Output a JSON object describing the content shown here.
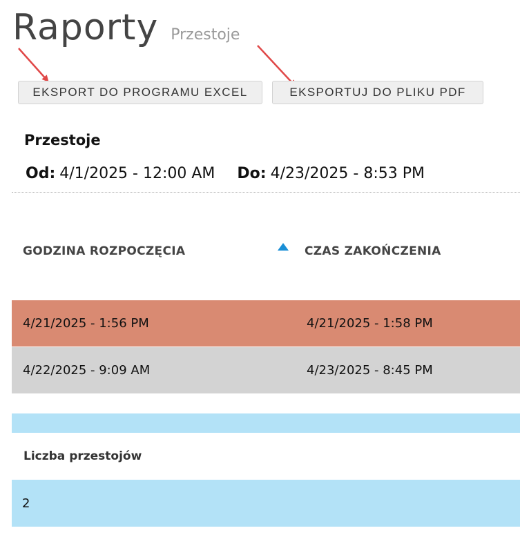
{
  "header": {
    "title": "Raporty",
    "subtitle": "Przestoje"
  },
  "toolbar": {
    "export_excel_label": "EKSPORT DO PROGRAMU EXCEL",
    "export_pdf_label": "EKSPORTUJ DO PLIKU PDF"
  },
  "report": {
    "title": "Przestoje",
    "from_label": "Od:",
    "from_value": "4/1/2025 - 12:00 AM",
    "to_label": "Do:",
    "to_value": "4/23/2025 - 8:53 PM"
  },
  "table": {
    "columns": [
      "GODZINA ROZPOCZĘCIA",
      "CZAS ZAKOŃCZENIA"
    ],
    "sort_icon": "sort-ascending-icon",
    "rows": [
      {
        "start": "4/21/2025 - 1:56 PM",
        "end": "4/21/2025 - 1:58 PM",
        "color": "#d98a72"
      },
      {
        "start": "4/22/2025 - 9:09 AM",
        "end": "4/23/2025 - 8:45 PM",
        "color": "#d3d3d3"
      }
    ]
  },
  "summary": {
    "count_label": "Liczba przestojów",
    "count_value": "2",
    "color": "#b3e2f7"
  },
  "annotations": {
    "arrow_color": "#e04848"
  }
}
